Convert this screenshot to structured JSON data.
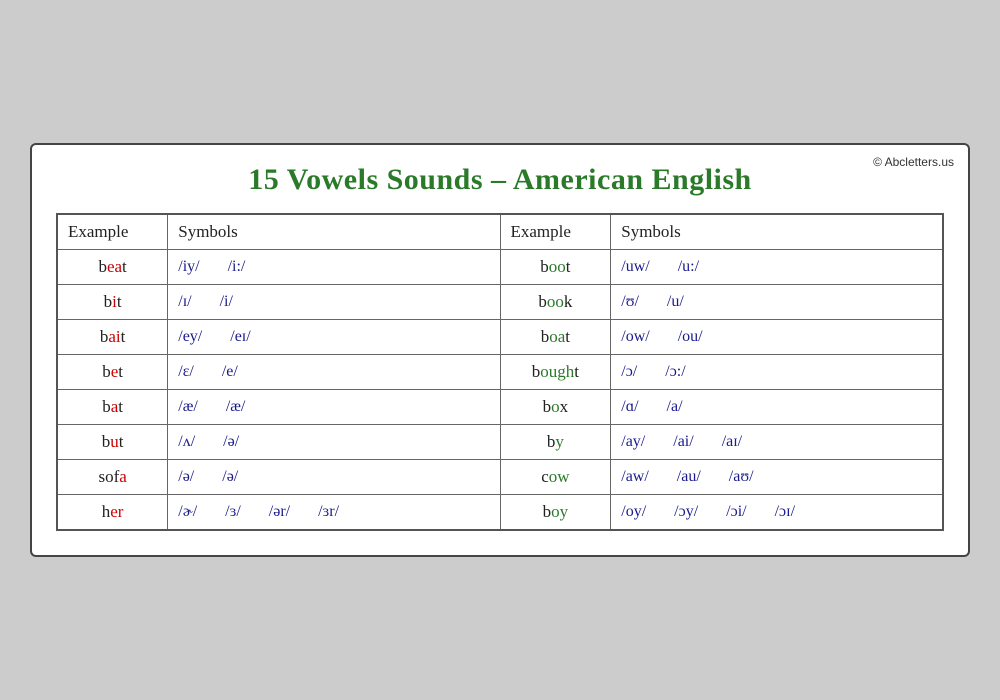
{
  "page": {
    "copyright": "© Abcletters.us",
    "title": "15 Vowels Sounds – American English"
  },
  "table": {
    "headers": [
      "Example",
      "Symbols",
      "Example",
      "Symbols"
    ],
    "rows": [
      {
        "ex1": {
          "pre": "b",
          "vowel": "ea",
          "post": "t"
        },
        "sym1": [
          "/iy/",
          "/i:/"
        ],
        "ex2": {
          "pre": "b",
          "vowel": "oo",
          "post": "t"
        },
        "sym2": [
          "/uw/",
          "/u:/"
        ]
      },
      {
        "ex1": {
          "pre": "b",
          "vowel": "i",
          "post": "t"
        },
        "sym1": [
          "/ɪ/",
          "/i/"
        ],
        "ex2": {
          "pre": "b",
          "vowel": "oo",
          "post": "k"
        },
        "sym2": [
          "/ʊ/",
          "/u/"
        ]
      },
      {
        "ex1": {
          "pre": "b",
          "vowel": "ai",
          "post": "t"
        },
        "sym1": [
          "/ey/",
          "/eɪ/"
        ],
        "ex2": {
          "pre": "b",
          "vowel": "oa",
          "post": "t"
        },
        "sym2": [
          "/ow/",
          "/ou/"
        ]
      },
      {
        "ex1": {
          "pre": "b",
          "vowel": "e",
          "post": "t"
        },
        "sym1": [
          "/ɛ/",
          "/e/"
        ],
        "ex2": {
          "pre": "b",
          "vowel": "ough",
          "post": "t"
        },
        "sym2": [
          "/ɔ/",
          "/ɔ:/"
        ]
      },
      {
        "ex1": {
          "pre": "b",
          "vowel": "a",
          "post": "t"
        },
        "sym1": [
          "/æ/",
          "/æ/"
        ],
        "ex2": {
          "pre": "b",
          "vowel": "o",
          "post": "x"
        },
        "sym2": [
          "/ɑ/",
          "/a/"
        ]
      },
      {
        "ex1": {
          "pre": "b",
          "vowel": "u",
          "post": "t"
        },
        "sym1": [
          "/ʌ/",
          "/ə/"
        ],
        "ex2": {
          "pre": "b",
          "vowel": "y",
          "post": ""
        },
        "sym2": [
          "/ay/",
          "/ai/",
          "/aɪ/"
        ]
      },
      {
        "ex1": {
          "pre": "sof",
          "vowel": "a",
          "post": ""
        },
        "sym1": [
          "/ə/",
          "/ə/"
        ],
        "ex2": {
          "pre": "c",
          "vowel": "ow",
          "post": ""
        },
        "sym2": [
          "/aw/",
          "/au/",
          "/aʊ/"
        ]
      },
      {
        "ex1": {
          "pre": "h",
          "vowel": "er",
          "post": ""
        },
        "sym1": [
          "/ɚ/",
          "/ɜ/",
          "/ər/",
          "/ɜr/"
        ],
        "ex2": {
          "pre": "b",
          "vowel": "oy",
          "post": ""
        },
        "sym2": [
          "/oy/",
          "/ɔy/",
          "/ɔi/",
          "/ɔɪ/"
        ]
      }
    ]
  }
}
